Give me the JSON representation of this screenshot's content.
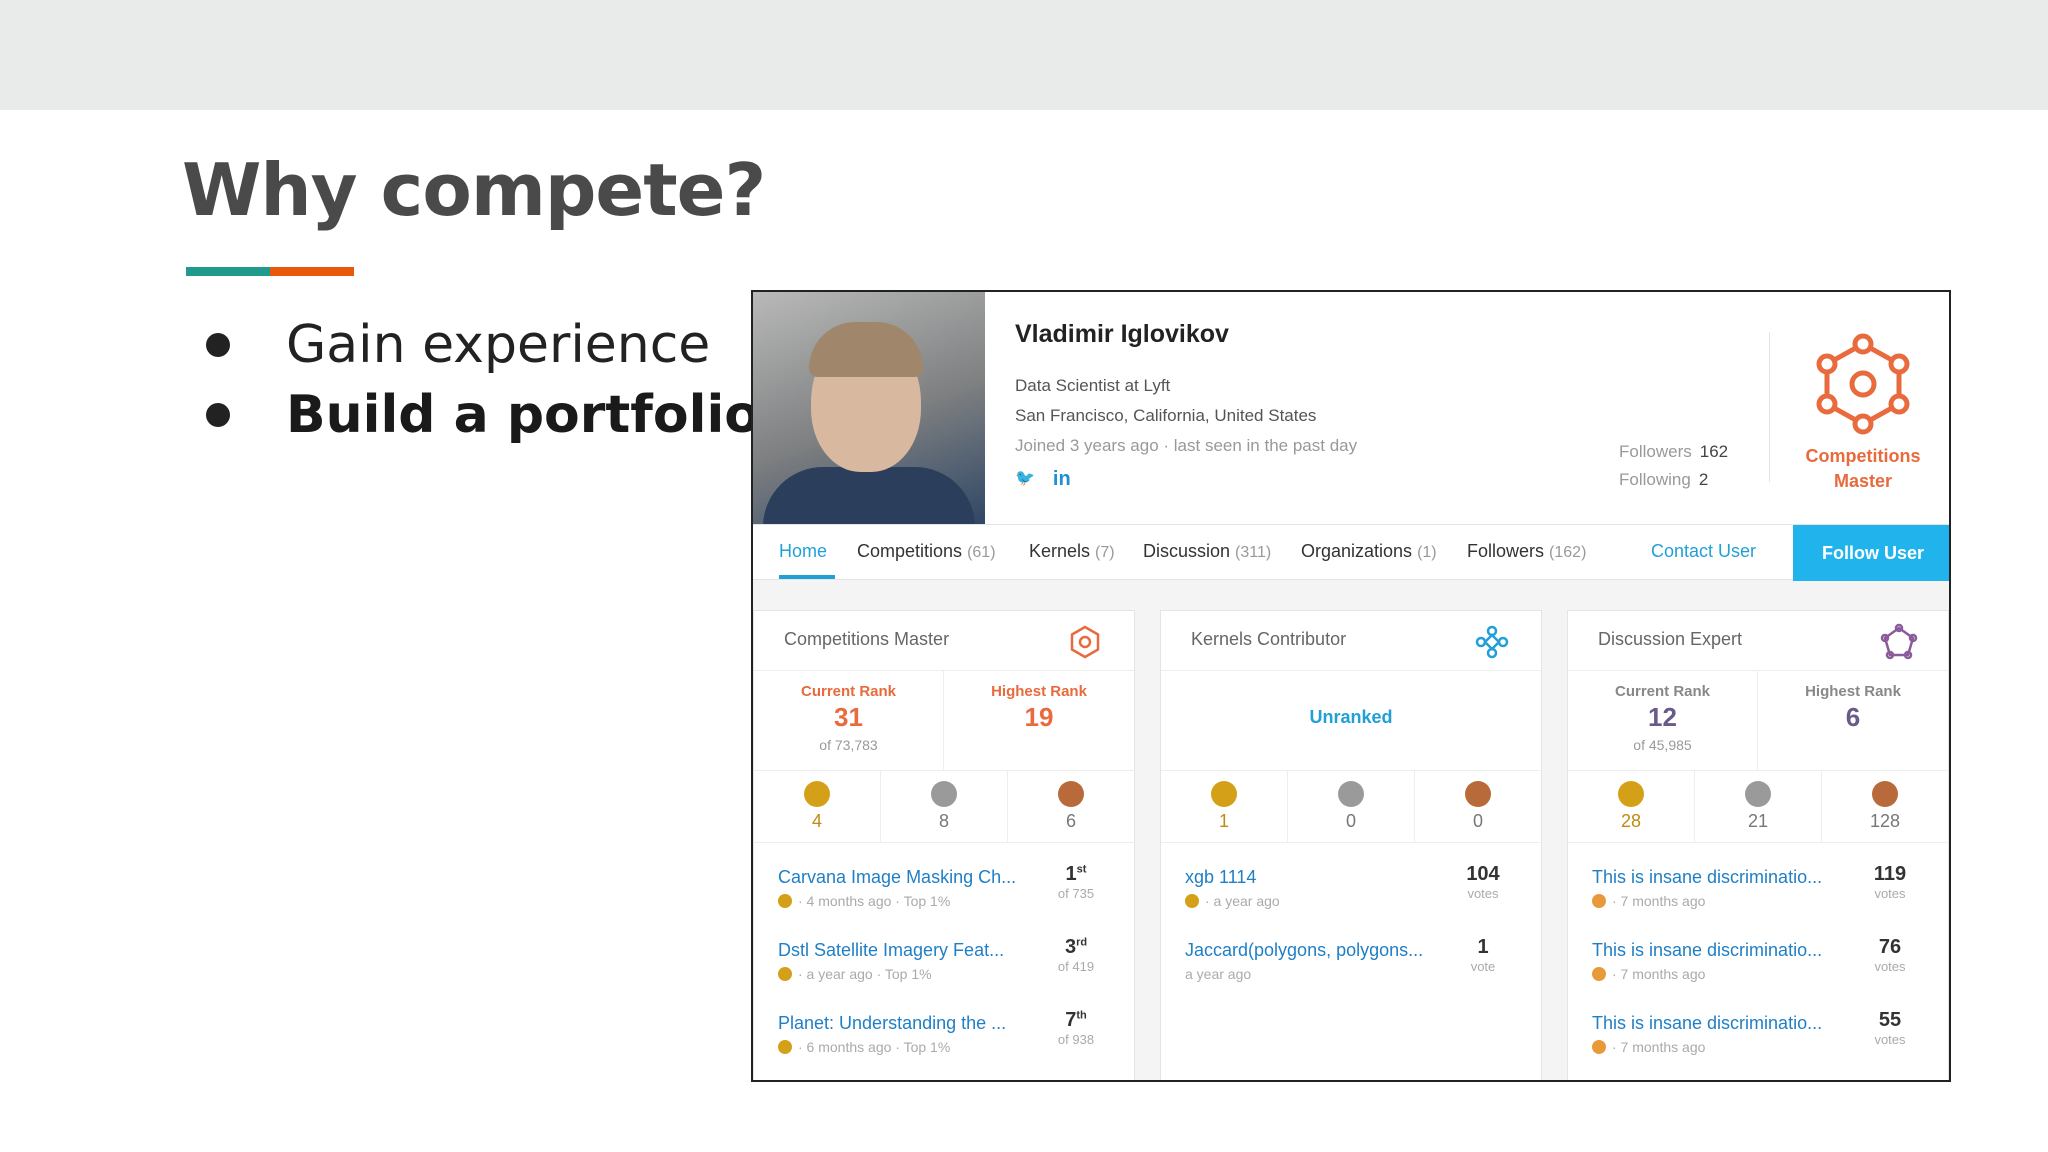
{
  "slide": {
    "title": "Why compete?",
    "bullets": [
      "Gain experience",
      "Build a portfolio"
    ]
  },
  "profile": {
    "name": "Vladimir Iglovikov",
    "job": "Data Scientist at Lyft",
    "location": "San Francisco, California, United States",
    "joined": "Joined 3 years ago · last seen in the past day",
    "social": [
      "twitter-icon",
      "linkedin-icon"
    ],
    "twitter_glyph": "🐦",
    "linkedin_glyph": "in",
    "followers_label": "Followers",
    "followers_value": "162",
    "following_label": "Following",
    "following_value": "2",
    "badge_line1": "Competitions",
    "badge_line2": "Master"
  },
  "tabs": {
    "items": [
      {
        "label": "Home",
        "count": ""
      },
      {
        "label": "Competitions",
        "count": "(61)"
      },
      {
        "label": "Kernels",
        "count": "(7)"
      },
      {
        "label": "Discussion",
        "count": "(311)"
      },
      {
        "label": "Organizations",
        "count": "(1)"
      },
      {
        "label": "Followers",
        "count": "(162)"
      }
    ],
    "contact": "Contact User",
    "follow": "Follow User"
  },
  "cards": [
    {
      "title": "Competitions Master",
      "current_label": "Current Rank",
      "current_value": "31",
      "current_of": "of 73,783",
      "highest_label": "Highest Rank",
      "highest_value": "19",
      "medals": [
        "4",
        "8",
        "6"
      ],
      "items": [
        {
          "title": "Carvana Image Masking Ch...",
          "sub": "· 4 months ago · Top 1%",
          "rank": "1",
          "sup": "st",
          "of": "of 735"
        },
        {
          "title": "Dstl Satellite Imagery Feat...",
          "sub": "· a year ago · Top 1%",
          "rank": "3",
          "sup": "rd",
          "of": "of 419"
        },
        {
          "title": "Planet: Understanding the ...",
          "sub": "· 6 months ago · Top 1%",
          "rank": "7",
          "sup": "th",
          "of": "of 938"
        }
      ]
    },
    {
      "title": "Kernels Contributor",
      "unranked": "Unranked",
      "medals": [
        "1",
        "0",
        "0"
      ],
      "items": [
        {
          "title": "xgb 1114",
          "sub": "· a year ago",
          "votes": "104",
          "votes_label": "votes"
        },
        {
          "title": "Jaccard(polygons, polygons...",
          "sub": "a year ago",
          "votes": "1",
          "votes_label": "vote"
        }
      ]
    },
    {
      "title": "Discussion Expert",
      "current_label": "Current Rank",
      "current_value": "12",
      "current_of": "of 45,985",
      "highest_label": "Highest Rank",
      "highest_value": "6",
      "medals": [
        "28",
        "21",
        "128"
      ],
      "items": [
        {
          "title": "This is insane discriminatio...",
          "sub": "· 7 months ago",
          "votes": "119",
          "votes_label": "votes"
        },
        {
          "title": "This is insane discriminatio...",
          "sub": "· 7 months ago",
          "votes": "76",
          "votes_label": "votes"
        },
        {
          "title": "This is insane discriminatio...",
          "sub": "· 7 months ago",
          "votes": "55",
          "votes_label": "votes"
        }
      ]
    }
  ],
  "colors": {
    "competitions": "#e86a3d",
    "kernels": "#21a0d8",
    "discussion": "#8a5a9a",
    "gold": "#d4a017",
    "silver": "#9a9a9a",
    "bronze": "#b86a3a",
    "teal_accent": "#1f9a8c",
    "orange_accent": "#e8590c"
  }
}
